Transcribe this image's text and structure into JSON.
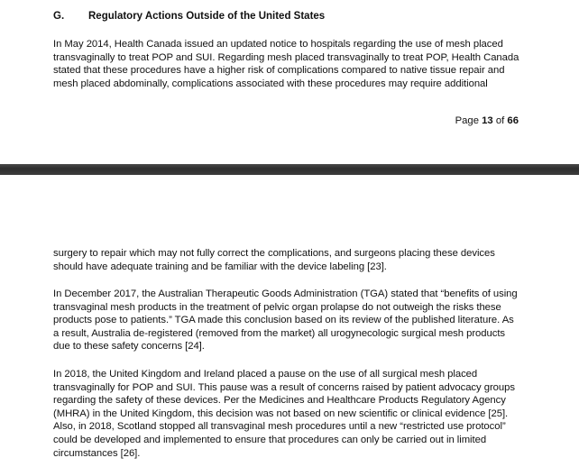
{
  "section": {
    "letter": "G.",
    "title": "Regulatory Actions Outside of the United States"
  },
  "page1": {
    "paragraph_lines": [
      "In May 2014, Health Canada issued an updated notice to hospitals regarding the use of mesh placed",
      "transvaginally to treat POP and SUI.  Regarding mesh placed transvaginally to treat POP, Health Canada",
      "stated that these procedures have a higher risk of complications compared to native tissue repair and",
      "mesh placed abdominally, complications associated with these procedures may require additional"
    ],
    "page_number": {
      "prefix": "Page",
      "current": "13",
      "of": "of",
      "total": "66"
    }
  },
  "page2": {
    "paragraphs": [
      {
        "lines": [
          "surgery to repair which may not fully correct the complications, and surgeons placing these devices",
          "should have adequate training and be familiar with the device labeling [23]."
        ]
      },
      {
        "lines": [
          "In December 2017, the Australian Therapeutic Goods Administration (TGA) stated that “benefits of using",
          "transvaginal mesh products in the treatment of pelvic organ prolapse do not outweigh the risks these",
          "products pose to patients.” TGA made this conclusion based on its review of the published literature. As",
          "a result, Australia de-registered (removed from the market) all urogynecologic surgical mesh products",
          "due to these safety concerns [24]."
        ]
      },
      {
        "lines": [
          "In 2018, the United Kingdom and Ireland placed a pause on the use of all surgical mesh placed",
          "transvaginally for POP and SUI.  This pause was a result of concerns raised by patient advocacy groups",
          "regarding the safety of these devices.  Per the Medicines and Healthcare Products Regulatory Agency",
          "(MHRA) in the United Kingdom, this decision was not based on new scientific or clinical evidence [25].",
          "Also, in 2018, Scotland stopped all transvaginal mesh procedures until a new “restricted use protocol”",
          "could be developed and implemented to ensure that procedures can only be carried out in limited",
          "circumstances [26]."
        ]
      }
    ]
  }
}
